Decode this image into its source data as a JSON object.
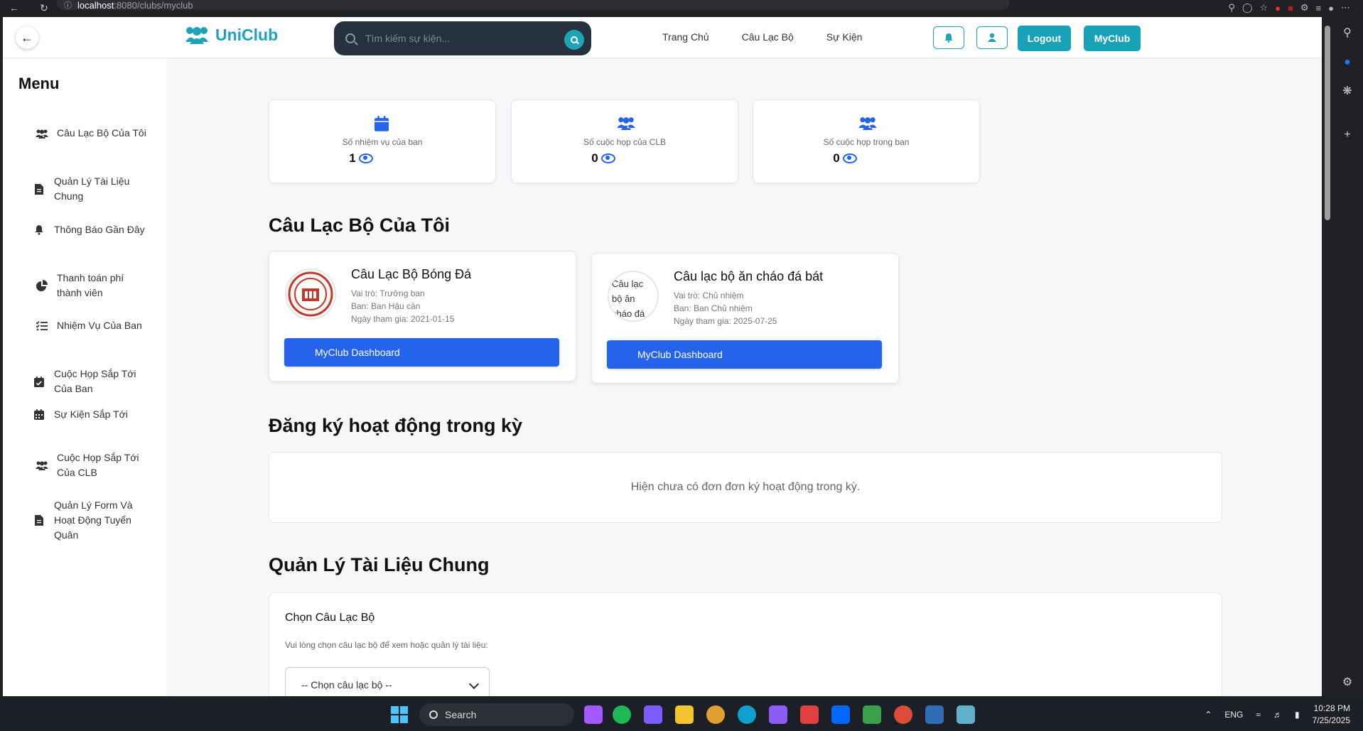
{
  "browser": {
    "url_host": "localhost",
    "url_path": ":8080/clubs/myclub"
  },
  "navbar": {
    "brand": "UniClub",
    "search_placeholder": "Tìm kiếm sự kiện...",
    "links": [
      "Trang Chủ",
      "Câu Lạc Bộ",
      "Sự Kiện"
    ],
    "logout_label": "Logout",
    "myclub_label": "MyClub",
    "accent_color": "#17a2b8"
  },
  "sidebar": {
    "title": "Menu",
    "items": [
      {
        "label": "Câu Lạc Bộ Của Tôi",
        "icon": "users-icon"
      },
      {
        "label": "Quản Lý Tài Liệu Chung",
        "icon": "file-icon"
      },
      {
        "label": "Thông Báo Gần Đây",
        "icon": "bell-icon"
      },
      {
        "label": "Thanh toán phí thành viên",
        "icon": "pie-chart-icon"
      },
      {
        "label": "Nhiệm Vụ Của Ban",
        "icon": "task-list-icon"
      },
      {
        "label": "Cuộc Họp Sắp Tới Của Ban",
        "icon": "calendar-check-icon"
      },
      {
        "label": "Sự Kiện Sắp Tới",
        "icon": "calendar-icon"
      },
      {
        "label": "Cuộc Họp Sắp Tới Của CLB",
        "icon": "users-icon"
      },
      {
        "label": "Quản Lý Form Và Hoạt Động Tuyển Quân",
        "icon": "file-icon"
      }
    ]
  },
  "stats": [
    {
      "label": "Số nhiệm vụ của ban",
      "value": "1",
      "icon": "calendar-icon"
    },
    {
      "label": "Số cuộc họp của CLB",
      "value": "0",
      "icon": "users-icon"
    },
    {
      "label": "Số cuộc họp trong ban",
      "value": "0",
      "icon": "users-icon"
    }
  ],
  "my_clubs": {
    "title": "Câu Lạc Bộ Của Tôi",
    "clubs": [
      {
        "name": "Câu Lạc Bộ Bóng Đá",
        "role": "Vai trò: Trưởng ban",
        "dept": "Ban: Ban Hậu cần",
        "joined": "Ngày tham gia: 2021-01-15",
        "button": "MyClub Dashboard",
        "logo_alt": ""
      },
      {
        "name": "Câu lạc bộ ăn cháo đá bát",
        "role": "Vai trò: Chủ nhiệm",
        "dept": "Ban: Ban Chủ nhiệm",
        "joined": "Ngày tham gia: 2025-07-25",
        "button": "MyClub Dashboard",
        "logo_alt": "Câu lạc bộ ăn cháo đá"
      }
    ]
  },
  "activity": {
    "title": "Đăng ký hoạt động trong kỳ",
    "empty_text": "Hiện chưa có đơn đơn ký hoạt động trong kỳ."
  },
  "documents": {
    "title": "Quản Lý Tài Liệu Chung",
    "select_title": "Chọn Câu Lạc Bộ",
    "select_help": "Vui lòng chọn câu lạc bộ để xem hoặc quản lý tài liệu:",
    "select_value": "-- Chọn câu lạc bộ --"
  },
  "taskbar": {
    "search_label": "Search",
    "lang": "ENG",
    "time": "10:28 PM",
    "date": "7/25/2025"
  }
}
